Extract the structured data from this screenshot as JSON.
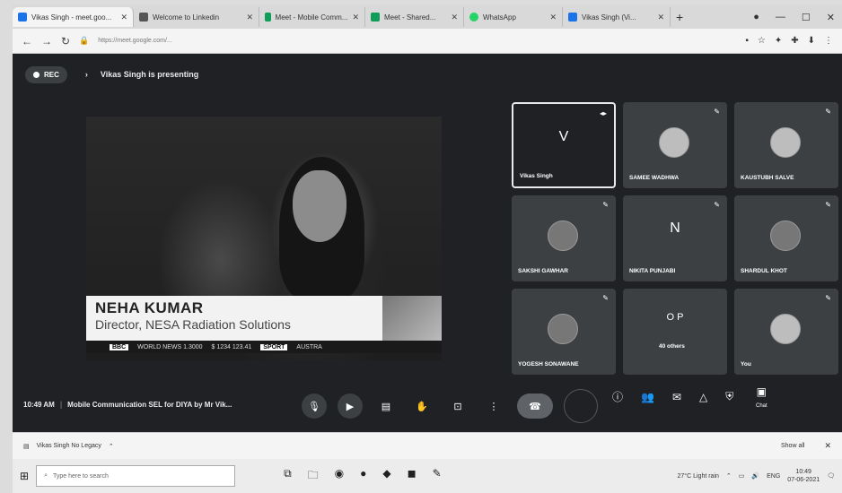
{
  "browser": {
    "tabs": [
      {
        "label": "Vikas Singh - meet.goo...",
        "color": "#1a73e8"
      },
      {
        "label": "Welcome to Linkedin",
        "color": "#555555"
      },
      {
        "label": "Meet - Mobile Comm...",
        "color": "#0f9d58"
      },
      {
        "label": "Meet - Shared...",
        "color": "#0f9d58"
      },
      {
        "label": "WhatsApp",
        "color": "#25d366"
      },
      {
        "label": "Vikas Singh (Vi...",
        "color": "#1a73e8"
      }
    ],
    "new_tab": "+",
    "url": "https://meet.google.com/..."
  },
  "meet": {
    "rec_label": "REC",
    "presenting_text": "Vikas Singh is presenting",
    "share": {
      "lower_name": "NEHA KUMAR",
      "lower_role": "Director, NESA Radiation Solutions",
      "ticker_bbc": "BBC",
      "ticker_text": "WORLD NEWS  1.3000",
      "ticker_price": "$ 1234  123.41",
      "ticker_sport": "SPORT",
      "ticker_tail": "AUSTRA"
    },
    "tiles": [
      {
        "name": "Vikas Singh",
        "letter": "V",
        "kind": "letter"
      },
      {
        "name": "SAMEE WADHWA",
        "kind": "avatar"
      },
      {
        "name": "KAUSTUBH SALVE",
        "kind": "avatar"
      },
      {
        "name": "SAKSHI GAWHAR",
        "kind": "avatar"
      },
      {
        "name": "NIKITA PUNJABI",
        "letter": "N",
        "kind": "letter"
      },
      {
        "name": "SHARDUL KHOT",
        "kind": "avatar"
      },
      {
        "name": "YOGESH SONAWANE",
        "kind": "avatar"
      },
      {
        "name": "40 others",
        "letter": "O P",
        "kind": "letter"
      },
      {
        "name": "You",
        "kind": "avatar"
      }
    ],
    "time": "10:49 AM",
    "meeting_title": "Mobile Communication SEL for DIYA by Mr Vik...",
    "chat_label": "Chat"
  },
  "shelf": {
    "item": "Vikas Singh No Legacy",
    "show_all": "Show all"
  },
  "taskbar": {
    "search_placeholder": "Type here to search",
    "weather": "27°C  Light rain",
    "lang": "ENG",
    "time": "10:49",
    "date": "07-06-2021"
  }
}
